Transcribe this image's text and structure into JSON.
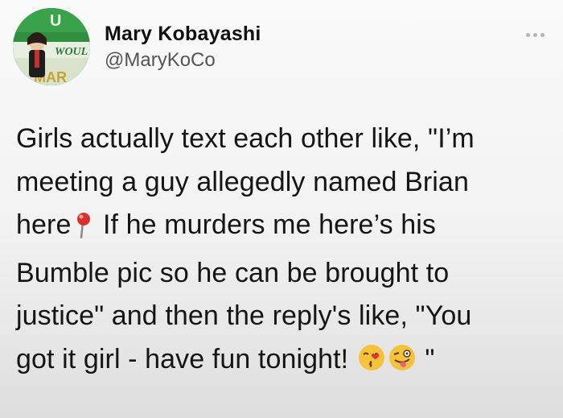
{
  "author": {
    "display_name": "Mary Kobayashi",
    "handle": "@MaryKoCo"
  },
  "avatar": {
    "sign_text": "WOUL",
    "sign_text_lower": "MAR"
  },
  "tweet": {
    "line_1": "Girls actually text each other like, \"I’m",
    "line_2": "meeting a guy allegedly named Brian",
    "line_3_before_pin": "here",
    "line_3_after_pin": " If he murders me here’s his",
    "line_4": "Bumble pic so he can be brought to",
    "line_5": "justice\" and then the reply's like, \"You",
    "line_6_before_emoji": "got it girl - have fun tonight!",
    "closing_quote": "\""
  },
  "icons": {
    "pin": "round-pushpin-icon",
    "kiss": "face-blowing-kiss-icon",
    "wink": "winking-face-tongue-icon",
    "more": "more-options-icon"
  }
}
